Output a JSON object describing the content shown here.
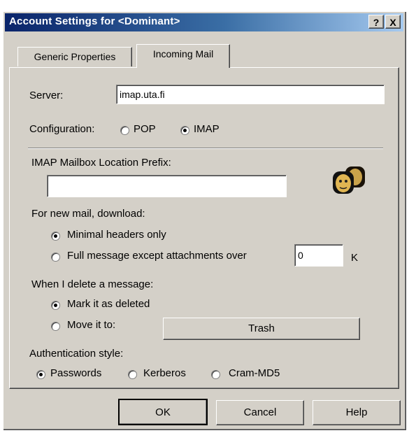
{
  "window": {
    "title": "Account Settings for <Dominant>",
    "help_glyph": "?",
    "close_glyph": "X"
  },
  "tabs": [
    {
      "label": "Generic Properties",
      "active": false
    },
    {
      "label": "Incoming Mail",
      "active": true
    }
  ],
  "server": {
    "label": "Server:",
    "value": "imap.uta.fi"
  },
  "configuration": {
    "label": "Configuration:",
    "options": [
      "POP",
      "IMAP"
    ],
    "selected": "IMAP"
  },
  "imap_prefix": {
    "label": "IMAP Mailbox Location Prefix:",
    "value": ""
  },
  "icon": {
    "name": "users-icon"
  },
  "new_mail": {
    "label": "For new mail, download:",
    "options": [
      "Minimal headers only",
      "Full message except attachments over"
    ],
    "selected": "Minimal headers only",
    "size_value": "0",
    "size_unit": "K"
  },
  "delete": {
    "label": "When I delete a message:",
    "options": [
      "Mark it as deleted",
      "Move it to:"
    ],
    "selected": "Mark it as deleted",
    "target_button": "Trash"
  },
  "auth": {
    "label": "Authentication style:",
    "options": [
      "Passwords",
      "Kerberos",
      "Cram-MD5"
    ],
    "selected": "Passwords"
  },
  "buttons": {
    "ok": "OK",
    "cancel": "Cancel",
    "help": "Help"
  }
}
